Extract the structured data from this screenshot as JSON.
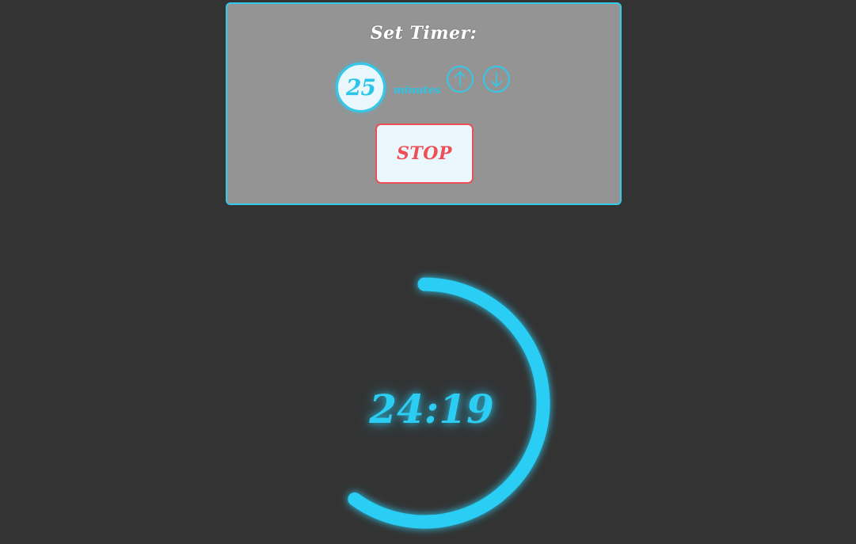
{
  "settings": {
    "title": "Set Timer:",
    "minutes_value": "25",
    "minutes_label": "minutes",
    "up_icon": "arrow-up-icon",
    "down_icon": "arrow-down-icon",
    "stop_label": "STOP"
  },
  "timer": {
    "time_display": "24:19",
    "progress_fraction": 0.6
  },
  "colors": {
    "accent": "#33c9ea",
    "stop": "#ee4f57",
    "panel_bg": "#949494",
    "page_bg": "#333333"
  }
}
